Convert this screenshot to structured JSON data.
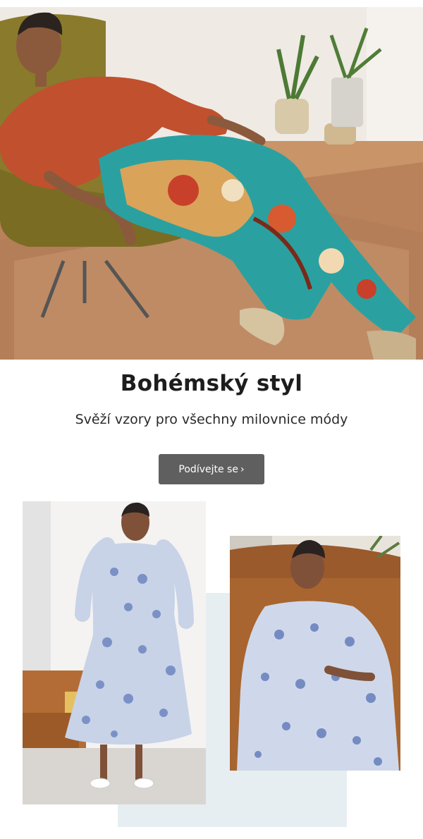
{
  "hero": {
    "headline": "Bohémský styl",
    "subline": "Svěží vzory pro všechny milovnice módy"
  },
  "cta": {
    "label": "Podívejte se",
    "chevron": "›"
  },
  "colors": {
    "button_bg": "#5f5f5f",
    "panel_bg": "#e6eef2",
    "text": "#1d1d1d"
  },
  "images": {
    "hero": "hero-photo",
    "left": "product-photo-left",
    "right": "product-photo-right"
  }
}
